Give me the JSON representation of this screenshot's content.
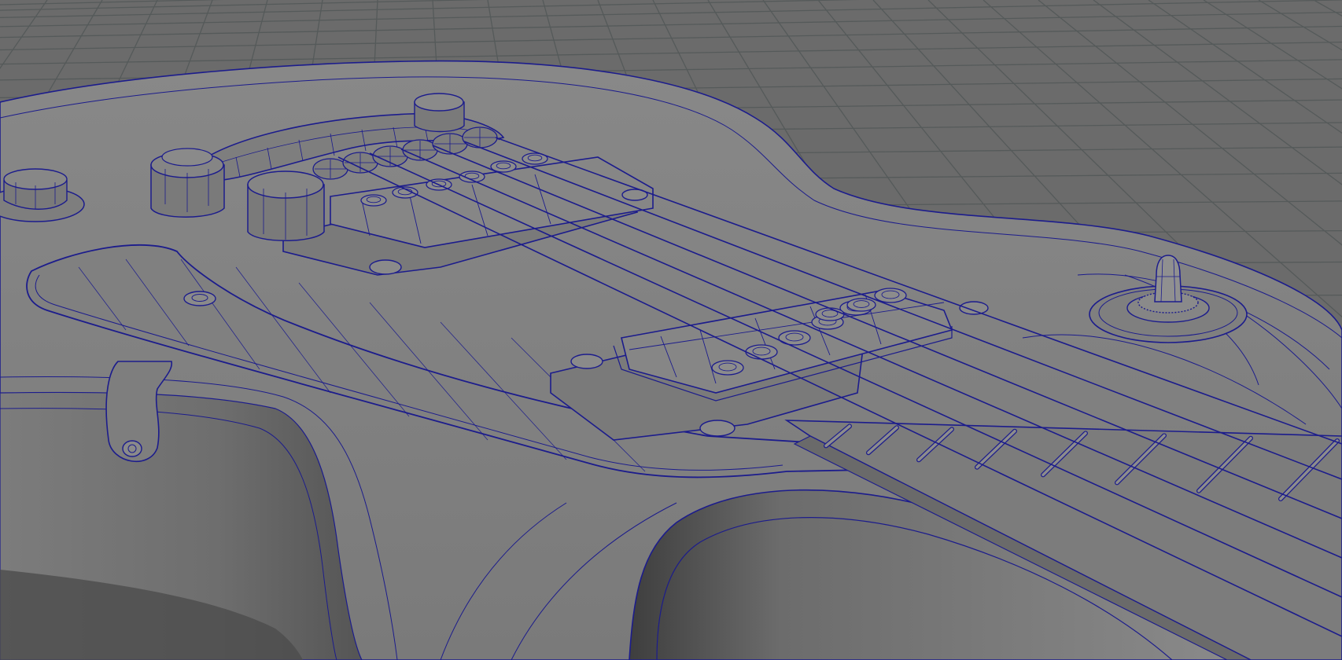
{
  "viewport": {
    "mode": "3d-perspective-wireframe-on-shaded",
    "subject": "electric-guitar-body",
    "colors": {
      "background": "#6b6b6b",
      "grid": "#555a5a",
      "body_fill": "#828282",
      "body_fill_dark": "#6a6a6a",
      "shadow": "#4a4a4a",
      "wire": "#1c1c8c",
      "metal": "#8a8a8a"
    },
    "components": {
      "body": "guitar-body",
      "pickguard": "pickguard",
      "tailpiece": "tailpiece-bar",
      "bridge_pickup": "bridge-humbucker",
      "neck_pickup": "neck-humbucker",
      "strings": 6,
      "fretboard": "fretboard",
      "toggle_switch": "pickup-toggle-switch",
      "knob": "volume-knob",
      "strap_button": "strap-button",
      "bracket": "pickguard-bracket"
    }
  }
}
